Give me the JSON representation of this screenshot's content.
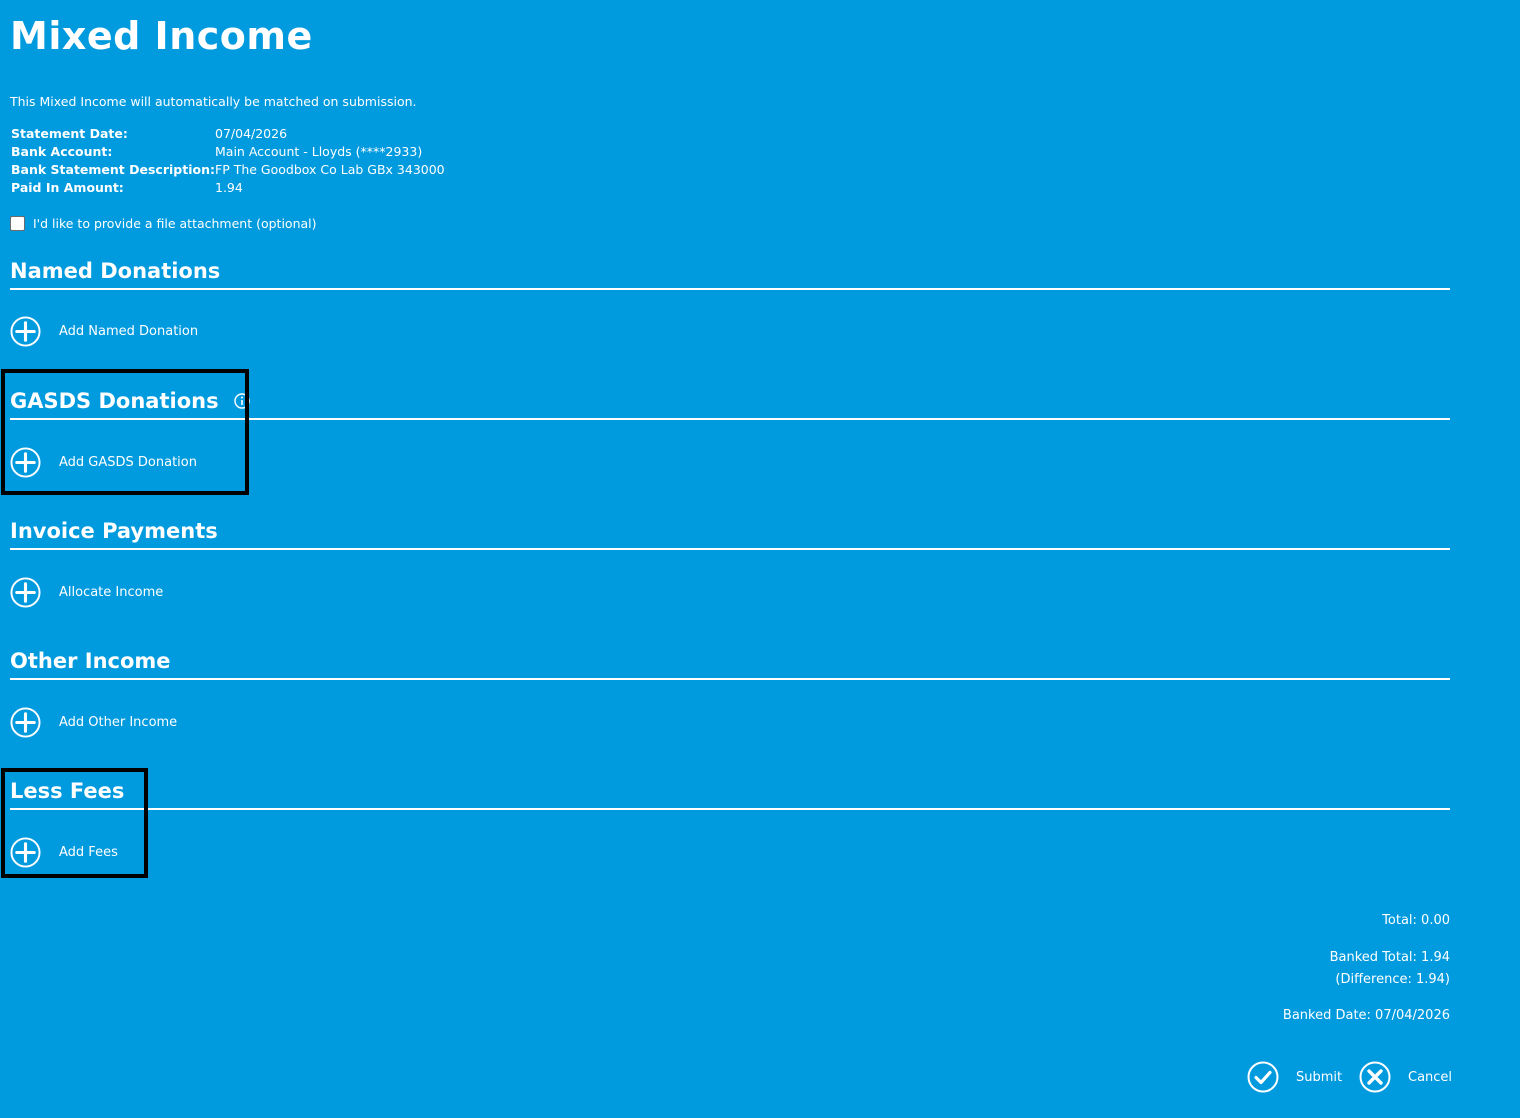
{
  "page": {
    "title": "Mixed Income",
    "intro": "This Mixed Income will automatically be matched on submission."
  },
  "details": {
    "statement_date_label": "Statement Date:",
    "statement_date": "07/04/2026",
    "bank_account_label": "Bank Account:",
    "bank_account": "Main Account - Lloyds (****2933)",
    "description_label": "Bank Statement Description:",
    "description": "FP The Goodbox Co Lab GBx 343000",
    "paid_in_label": "Paid In Amount:",
    "paid_in": "1.94"
  },
  "attachment": {
    "label": "I'd like to provide a file attachment (optional)",
    "checked": false
  },
  "sections": {
    "named": {
      "title": "Named Donations",
      "action": "Add Named Donation"
    },
    "gasds": {
      "title": "GASDS Donations",
      "action": "Add GASDS Donation",
      "icon": "info-icon"
    },
    "invoice": {
      "title": "Invoice Payments",
      "action": "Allocate Income"
    },
    "other": {
      "title": "Other Income",
      "action": "Add Other Income"
    },
    "fees": {
      "title": "Less Fees",
      "action": "Add Fees"
    }
  },
  "summary": {
    "total": "Total: 0.00",
    "banked_total": "Banked Total: 1.94",
    "difference": "(Difference: 1.94)",
    "banked_date": "Banked Date: 07/04/2026"
  },
  "actions": {
    "submit": "Submit",
    "cancel": "Cancel"
  },
  "colors": {
    "background": "#009ade",
    "foreground": "#ffffff",
    "highlight_border": "#000000"
  }
}
